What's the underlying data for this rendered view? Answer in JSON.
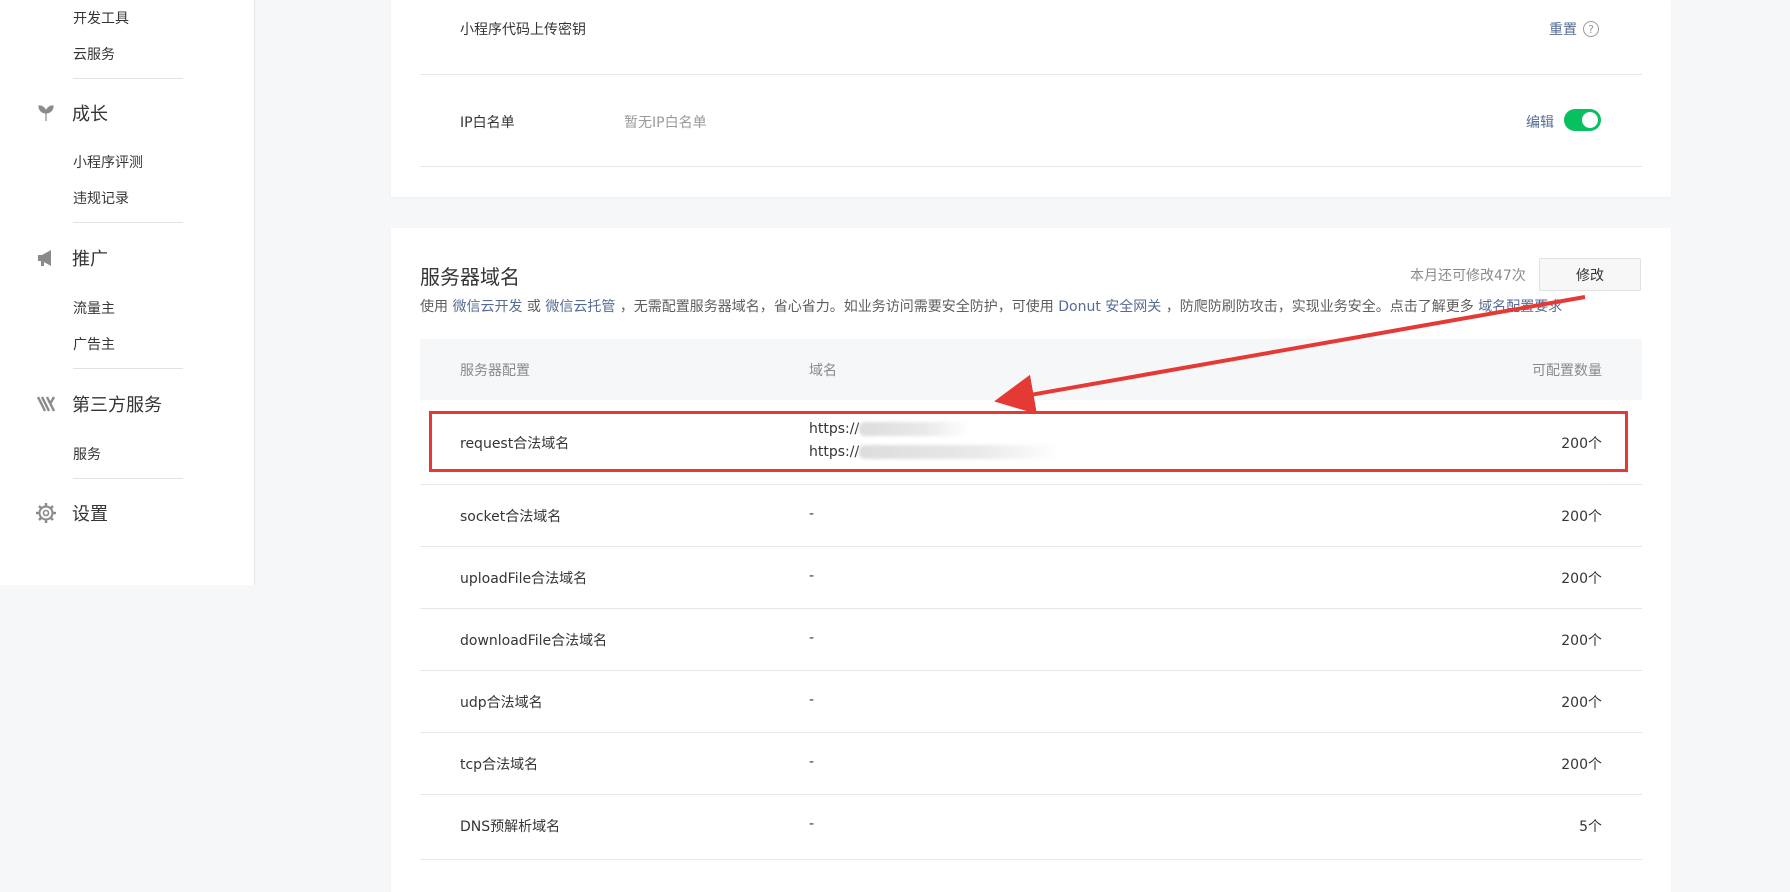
{
  "sidebar": {
    "top_items": [
      "开发工具",
      "云服务"
    ],
    "groups": [
      {
        "title": "成长",
        "icon": "sprout-icon",
        "items": [
          "小程序评测",
          "违规记录"
        ]
      },
      {
        "title": "推广",
        "icon": "megaphone-icon",
        "items": [
          "流量主",
          "广告主"
        ]
      },
      {
        "title": "第三方服务",
        "icon": "third-party-icon",
        "items": [
          "服务"
        ]
      },
      {
        "title": "设置",
        "icon": "gear-icon",
        "items": []
      }
    ]
  },
  "dev_settings": {
    "upload_key_label": "小程序代码上传密钥",
    "reset_label": "重置",
    "help_glyph": "?",
    "ip_whitelist_label": "IP白名单",
    "ip_whitelist_value": "暂无IP白名单",
    "edit_label": "编辑",
    "ip_toggle_on": true
  },
  "server_domain": {
    "title": "服务器域名",
    "quota_text": "本月还可修改47次",
    "modify_button": "修改",
    "desc_parts": {
      "p1": "使用",
      "link1": "微信云开发",
      "p2": "或",
      "link2": "微信云托管",
      "p3": "，无需配置服务器域名，省心省力。如业务访问需要安全防护，可使用",
      "link3": "Donut 安全网关",
      "p4": "，防爬防刷防攻击，实现业务安全。点击了解更多",
      "link4": "域名配置要求"
    },
    "columns": [
      "服务器配置",
      "域名",
      "可配置数量"
    ],
    "rows": [
      {
        "name": "request合法域名",
        "domains": [
          "https://",
          "https://"
        ],
        "count": "200个"
      },
      {
        "name": "socket合法域名",
        "domains": [
          "-"
        ],
        "count": "200个"
      },
      {
        "name": "uploadFile合法域名",
        "domains": [
          "-"
        ],
        "count": "200个"
      },
      {
        "name": "downloadFile合法域名",
        "domains": [
          "-"
        ],
        "count": "200个"
      },
      {
        "name": "udp合法域名",
        "domains": [
          "-"
        ],
        "count": "200个"
      },
      {
        "name": "tcp合法域名",
        "domains": [
          "-"
        ],
        "count": "200个"
      },
      {
        "name": "DNS预解析域名",
        "domains": [
          "-"
        ],
        "count": "5个"
      }
    ]
  },
  "annotation": {
    "highlight_color": "#e53935",
    "arrow_color": "#e53935"
  }
}
